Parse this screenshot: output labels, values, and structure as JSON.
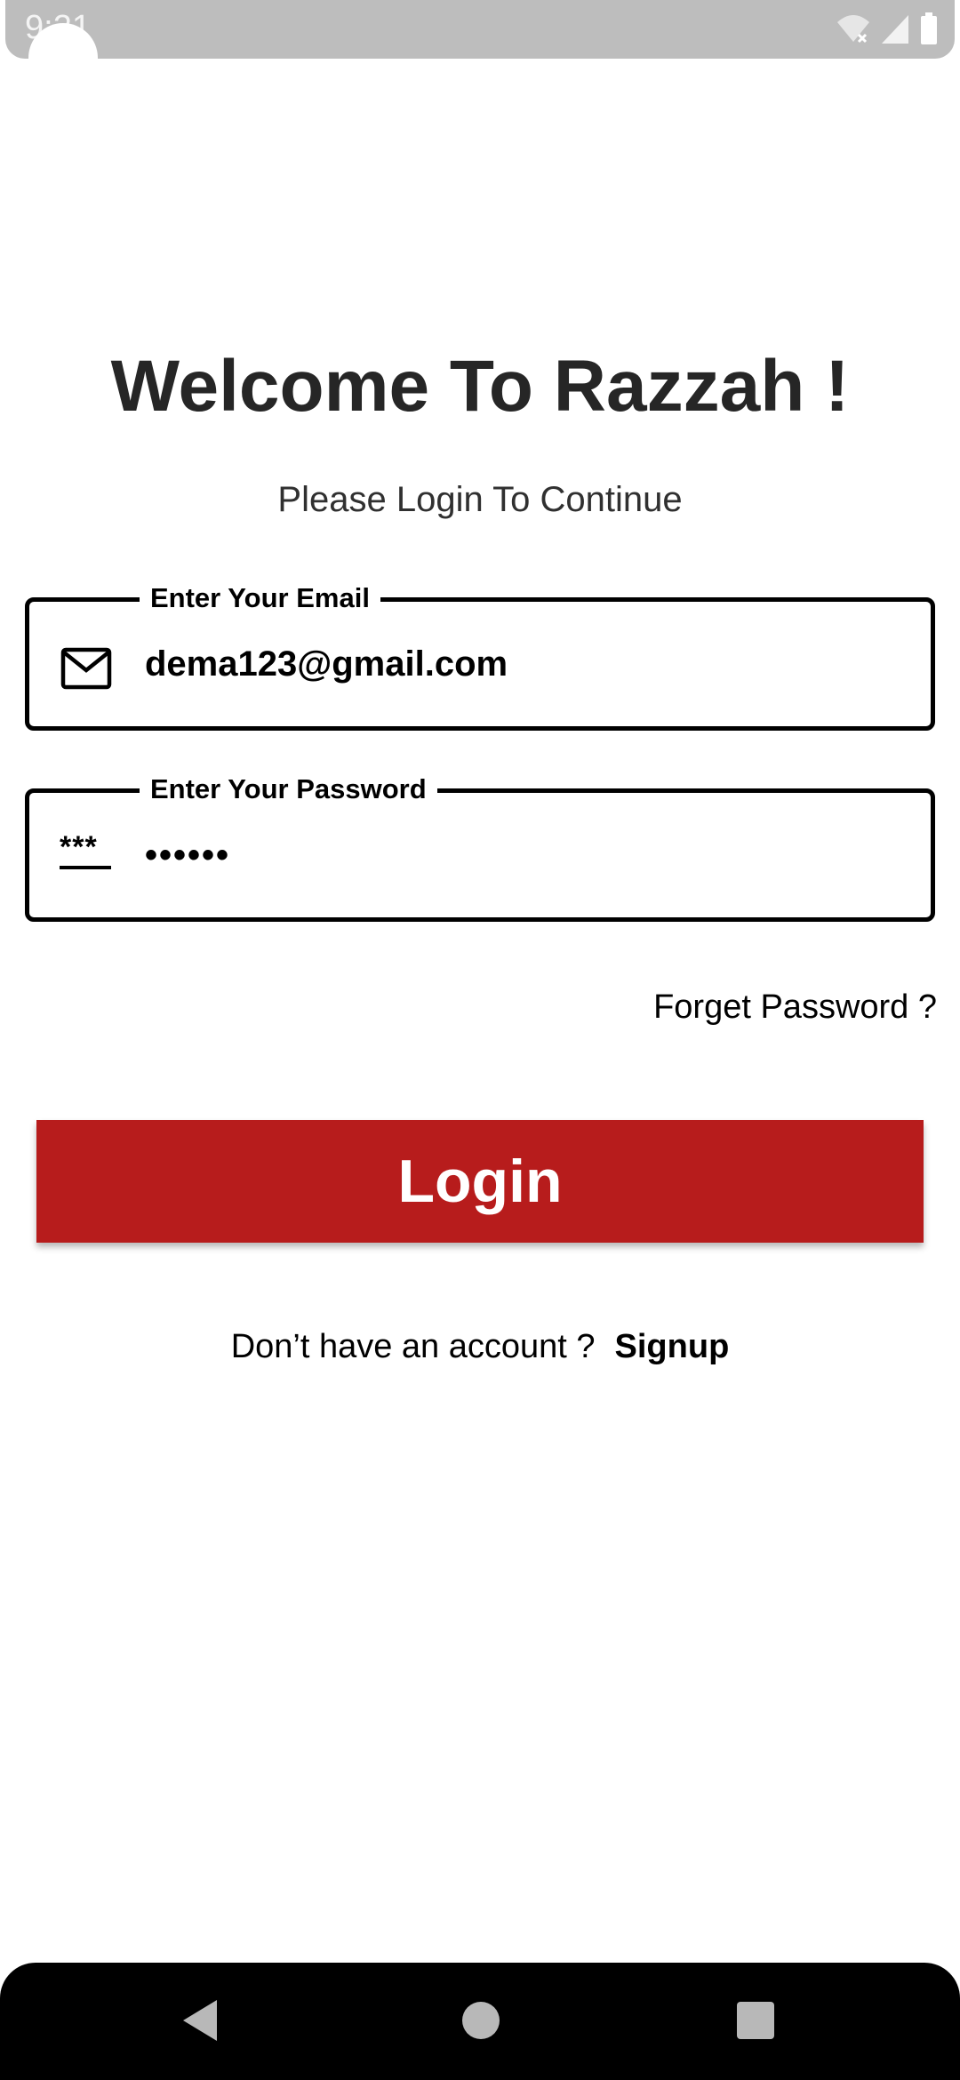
{
  "status_bar": {
    "time": "9:21",
    "icons": [
      "wifi-off-icon",
      "signal-icon",
      "battery-icon"
    ]
  },
  "welcome": {
    "title": "Welcome To Razzah !",
    "subtitle": "Please Login To Continue"
  },
  "email_field": {
    "label": "Enter Your Email",
    "value": "dema123@gmail.com",
    "icon": "mail-icon"
  },
  "password_field": {
    "label": "Enter Your Password",
    "value": "••••••",
    "icon_text": "***",
    "icon": "password-icon"
  },
  "forget_password": "Forget Password ?",
  "login_button": "Login",
  "signup": {
    "prompt": "Don’t have an account ?",
    "link": "Signup"
  },
  "nav_bar": {
    "buttons": [
      "back-icon",
      "home-icon",
      "recents-icon"
    ]
  },
  "colors": {
    "accent": "#b71c1c",
    "title": "#262626",
    "status_bar": "#bdbdbd",
    "nav_bar": "#000000"
  }
}
